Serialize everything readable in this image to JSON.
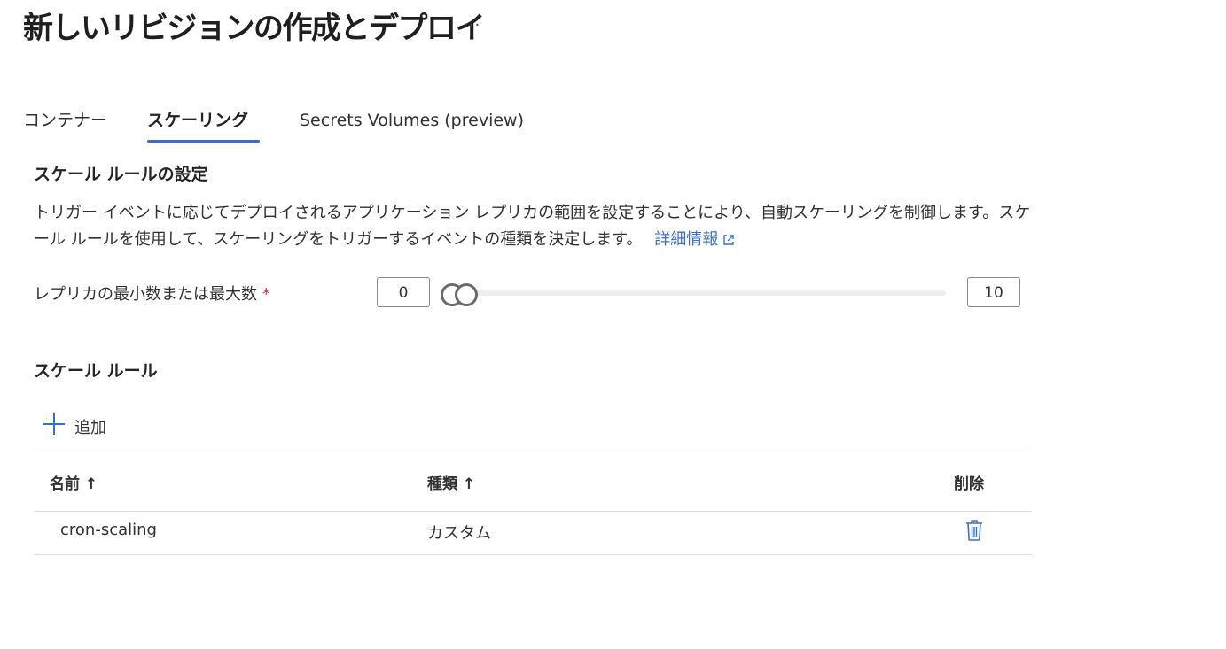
{
  "header": {
    "title": "新しいリビジョンの作成とデプロイ",
    "more_label": "···"
  },
  "tabs": [
    {
      "label": "コンテナー",
      "active": false
    },
    {
      "label": "スケーリング",
      "active": true
    },
    {
      "label": "Secrets Volumes (preview)",
      "active": false
    }
  ],
  "scale_settings": {
    "heading": "スケール ルールの設定",
    "description": "トリガー イベントに応じてデプロイされるアプリケーション レプリカの範囲を設定することにより、自動スケーリングを制御します。スケール ルールを使用して、スケーリングをトリガーするイベントの種類を決定します。",
    "learn_more": "詳細情報",
    "replica_label": "レプリカの最小数または最大数",
    "required_mark": "*",
    "min_value": "0",
    "max_value": "10",
    "slider": {
      "min": 0,
      "max": 10,
      "low": 0,
      "high": 0
    }
  },
  "rules": {
    "heading": "スケール ルール",
    "add_label": "追加",
    "columns": {
      "name": "名前 ↑",
      "type": "種類 ↑",
      "delete": "削除"
    },
    "rows": [
      {
        "name": "cron-scaling",
        "type": "カスタム"
      }
    ]
  },
  "colors": {
    "accent": "#3a6fc9",
    "required": "#c4314b"
  }
}
